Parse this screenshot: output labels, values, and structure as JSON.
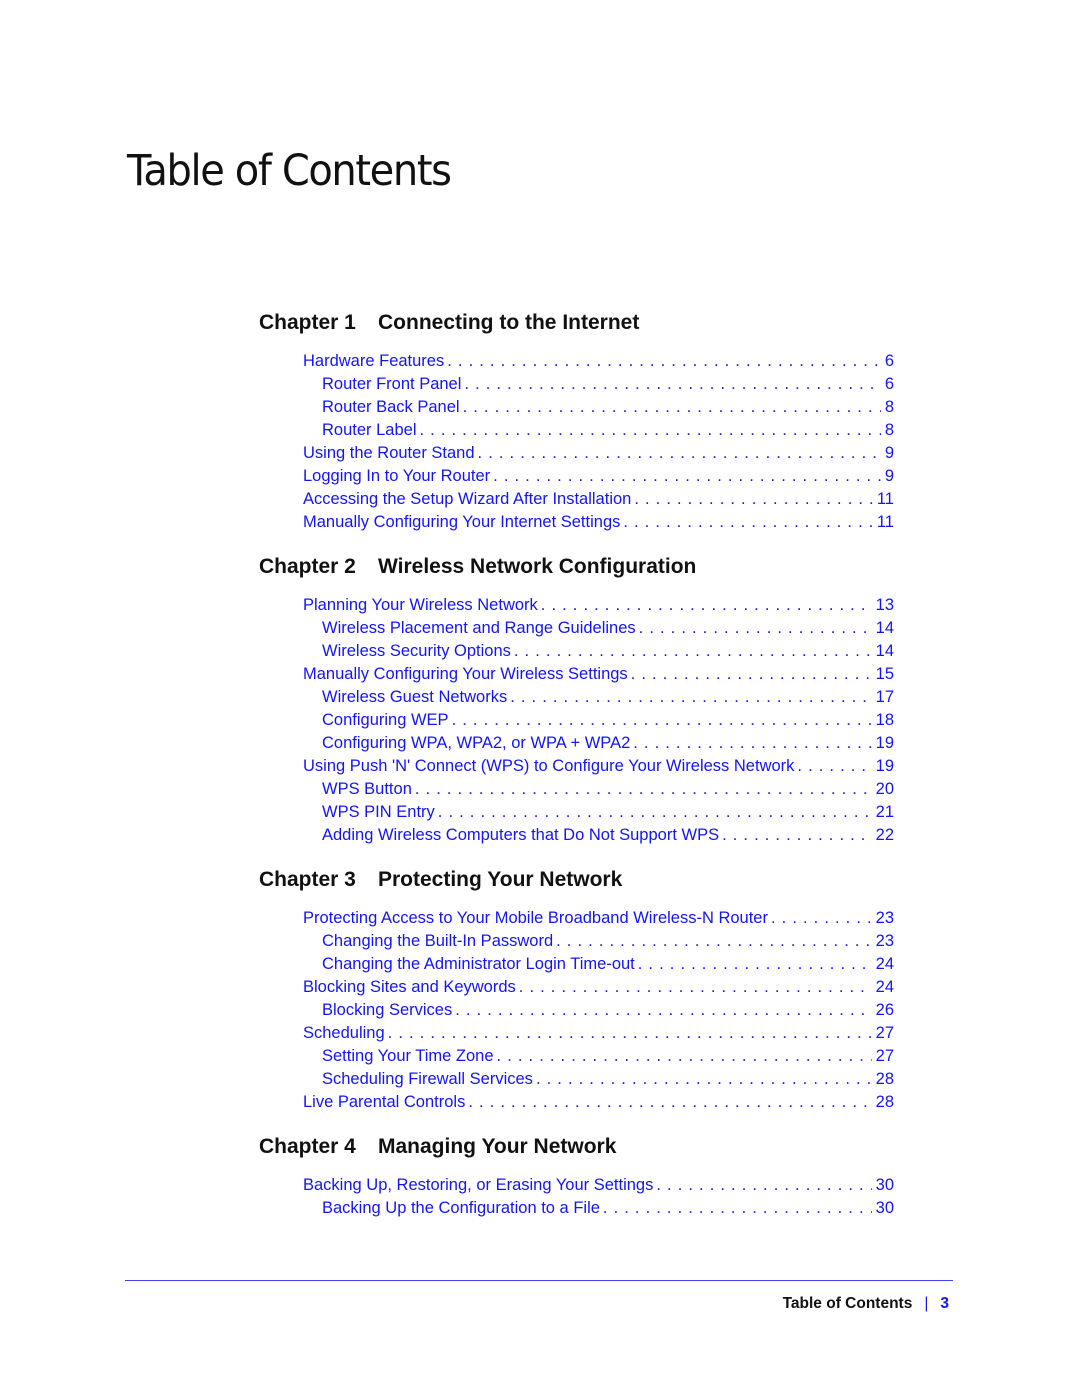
{
  "page_title": "Table of Contents",
  "chapters": [
    {
      "number": "Chapter 1",
      "title": "Connecting to the Internet",
      "entries": [
        {
          "label": "Hardware Features",
          "page": "6",
          "level": 1
        },
        {
          "label": "Router Front Panel",
          "page": "6",
          "level": 2
        },
        {
          "label": "Router Back Panel",
          "page": "8",
          "level": 2
        },
        {
          "label": "Router Label",
          "page": "8",
          "level": 2
        },
        {
          "label": "Using the Router Stand",
          "page": "9",
          "level": 1
        },
        {
          "label": "Logging In to Your Router",
          "page": "9",
          "level": 1
        },
        {
          "label": "Accessing the Setup Wizard After Installation",
          "page": "11",
          "level": 1
        },
        {
          "label": "Manually Configuring Your Internet Settings",
          "page": "11",
          "level": 1
        }
      ]
    },
    {
      "number": "Chapter 2",
      "title": "Wireless Network Configuration",
      "entries": [
        {
          "label": "Planning Your Wireless Network",
          "page": "13",
          "level": 1
        },
        {
          "label": "Wireless Placement and Range Guidelines",
          "page": "14",
          "level": 2
        },
        {
          "label": "Wireless Security Options",
          "page": "14",
          "level": 2
        },
        {
          "label": "Manually Configuring Your Wireless Settings",
          "page": "15",
          "level": 1
        },
        {
          "label": "Wireless Guest Networks",
          "page": "17",
          "level": 2
        },
        {
          "label": "Configuring WEP",
          "page": "18",
          "level": 2
        },
        {
          "label": "Configuring WPA, WPA2, or WPA + WPA2",
          "page": "19",
          "level": 2
        },
        {
          "label": "Using Push 'N' Connect (WPS) to Configure Your Wireless Network",
          "page": "19",
          "level": 1
        },
        {
          "label": "WPS Button",
          "page": "20",
          "level": 2
        },
        {
          "label": "WPS PIN Entry",
          "page": "21",
          "level": 2
        },
        {
          "label": "Adding Wireless Computers that Do Not Support WPS",
          "page": "22",
          "level": 2
        }
      ]
    },
    {
      "number": "Chapter 3",
      "title": "Protecting Your Network",
      "entries": [
        {
          "label": "Protecting Access to Your Mobile Broadband Wireless-N Router",
          "page": "23",
          "level": 1
        },
        {
          "label": "Changing the Built-In Password",
          "page": "23",
          "level": 2
        },
        {
          "label": "Changing the Administrator Login Time-out",
          "page": "24",
          "level": 2
        },
        {
          "label": "Blocking Sites and Keywords",
          "page": "24",
          "level": 1
        },
        {
          "label": "Blocking Services",
          "page": "26",
          "level": 2
        },
        {
          "label": "Scheduling",
          "page": "27",
          "level": 1
        },
        {
          "label": "Setting Your Time Zone",
          "page": "27",
          "level": 2
        },
        {
          "label": "Scheduling Firewall Services",
          "page": "28",
          "level": 2
        },
        {
          "label": "Live Parental Controls",
          "page": "28",
          "level": 1
        }
      ]
    },
    {
      "number": "Chapter 4",
      "title": "Managing Your Network",
      "entries": [
        {
          "label": "Backing Up, Restoring, or Erasing Your Settings",
          "page": "30",
          "level": 1
        },
        {
          "label": "Backing Up the Configuration to a File",
          "page": "30",
          "level": 2
        }
      ]
    }
  ],
  "footer": {
    "section": "Table of Contents",
    "separator": "|",
    "page_number": "3"
  },
  "colors": {
    "link": "#1414f5",
    "text": "#111111",
    "rule": "#4040f0"
  }
}
